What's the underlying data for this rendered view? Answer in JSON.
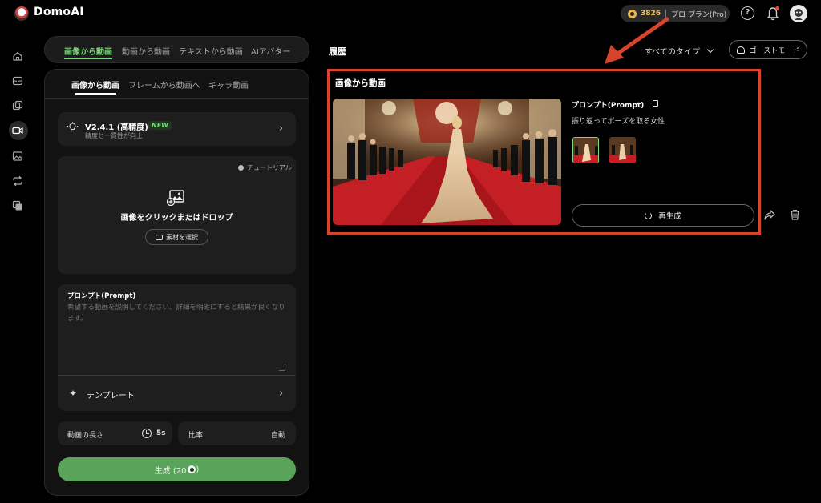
{
  "app": {
    "name": "DomoAI"
  },
  "header": {
    "credits": "3826",
    "plan": "プロ プラン(Pro)",
    "help": "?"
  },
  "mode_tabs": [
    {
      "label": "画像から動画"
    },
    {
      "label": "動画から動画"
    },
    {
      "label": "テキストから動画"
    },
    {
      "label": "AIアバター"
    }
  ],
  "sub_tabs": [
    {
      "label": "画像から動画"
    },
    {
      "label": "フレームから動画へ"
    },
    {
      "label": "キャラ動画"
    }
  ],
  "model": {
    "name": "V2.4.1 (高精度)",
    "badge": "NEW",
    "description": "精度と一貫性が向上"
  },
  "upload": {
    "tutorial": "チュートリアル",
    "label": "画像をクリックまたはドロップ",
    "pick_button": "素材を選択"
  },
  "prompt": {
    "title": "プロンプト(Prompt)",
    "placeholder": "希望する動画を説明してください。詳細を明確にすると結果が良くなります。"
  },
  "template": {
    "label": "テンプレート"
  },
  "settings": {
    "length_label": "動画の長さ",
    "length_value": "5s",
    "ratio_label": "比率",
    "ratio_value": "自動"
  },
  "generate": {
    "label": "生成 (20",
    "suffix": ")"
  },
  "history": {
    "title": "履歴",
    "type_filter": "すべてのタイプ",
    "ghost_mode": "ゴーストモード",
    "item": {
      "title": "画像から動画",
      "prompt_label": "プロンプト(Prompt)",
      "prompt_text": "振り返ってポーズを取る女性",
      "regenerate": "再生成"
    }
  },
  "colors": {
    "accent_green": "#7fd87f",
    "generate_green": "#5aa35a",
    "highlight_red": "#d8432e",
    "credit_gold": "#f0c35b"
  }
}
